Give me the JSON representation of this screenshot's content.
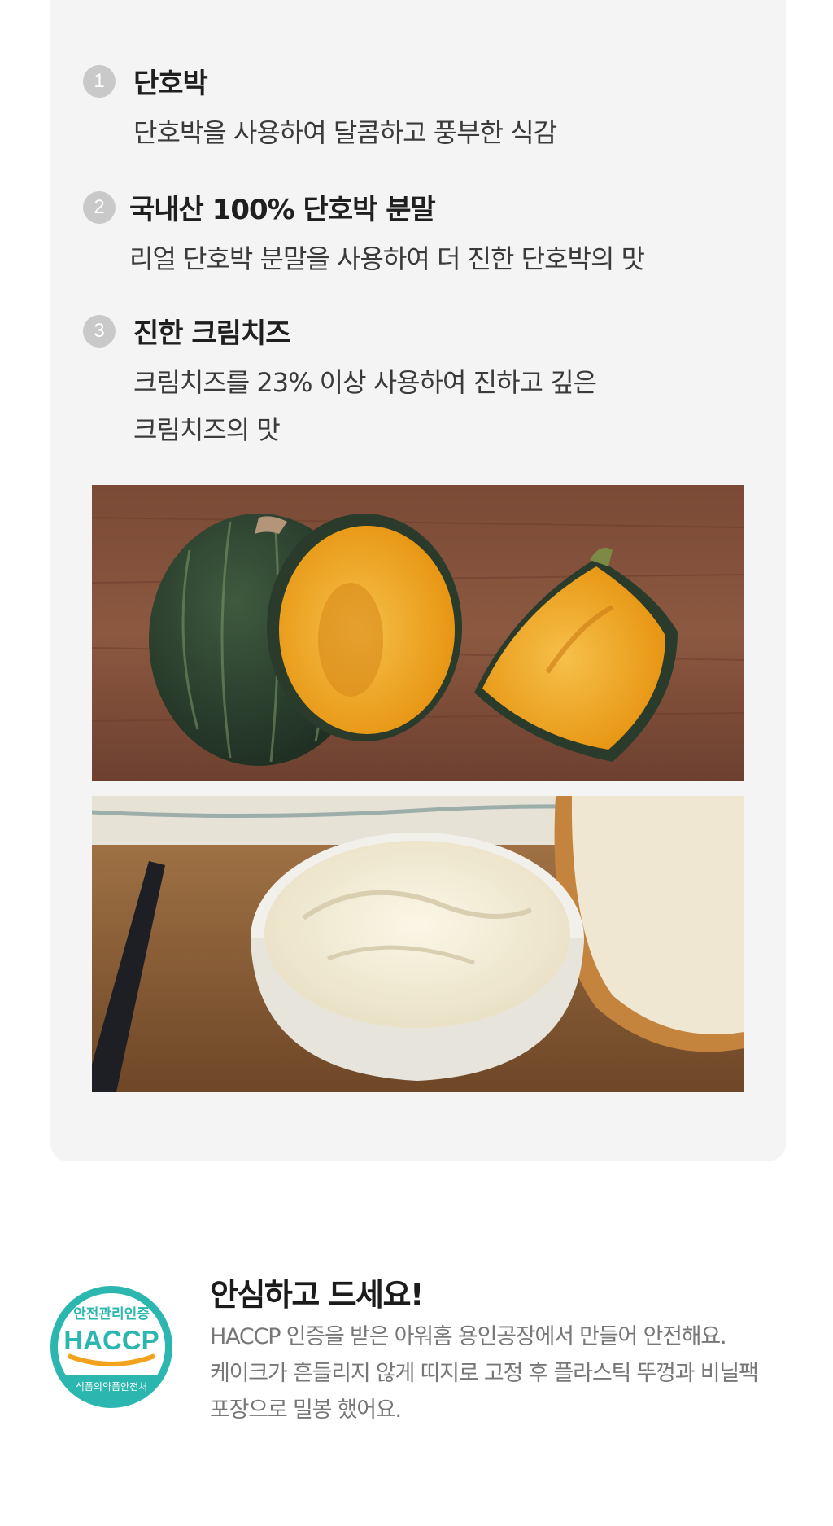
{
  "features": [
    {
      "number": "1",
      "title": "단호박",
      "desc_lines": [
        "단호박을 사용하여 달콤하고 풍부한 식감"
      ]
    },
    {
      "number": "2",
      "title": "국내산 100% 단호박 분말",
      "desc_lines": [
        "리얼 단호박 분말을 사용하여 더 진한 단호박의 맛"
      ]
    },
    {
      "number": "3",
      "title": "진한 크림치즈",
      "desc_lines": [
        "크림치즈를 23% 이상 사용하여 진하고 깊은",
        "크림치즈의 맛"
      ]
    }
  ],
  "photos": {
    "pumpkin": "pumpkin-photo",
    "cream_cheese": "cream-cheese-photo"
  },
  "safety": {
    "badge": {
      "top_text": "안전관리인증",
      "main_text": "HACCP",
      "bottom_text": "식품의약품안전처",
      "color": "#2bb7b0",
      "accent": "#f2a21d"
    },
    "title": "안심하고 드세요!",
    "desc_lines": [
      "HACCP 인증을 받은 아워홈 용인공장에서 만들어 안전해요.",
      "케이크가 흔들리지 않게 띠지로 고정 후 플라스틱 뚜껑과 비닐팩",
      "포장으로 밀봉 했어요."
    ]
  },
  "colors": {
    "card_bg": "#f4f4f4",
    "number_circle": "#c9c9c9",
    "title_text": "#1f1f1f",
    "desc_text": "#3a3a3a",
    "safety_desc_text": "#777777"
  }
}
